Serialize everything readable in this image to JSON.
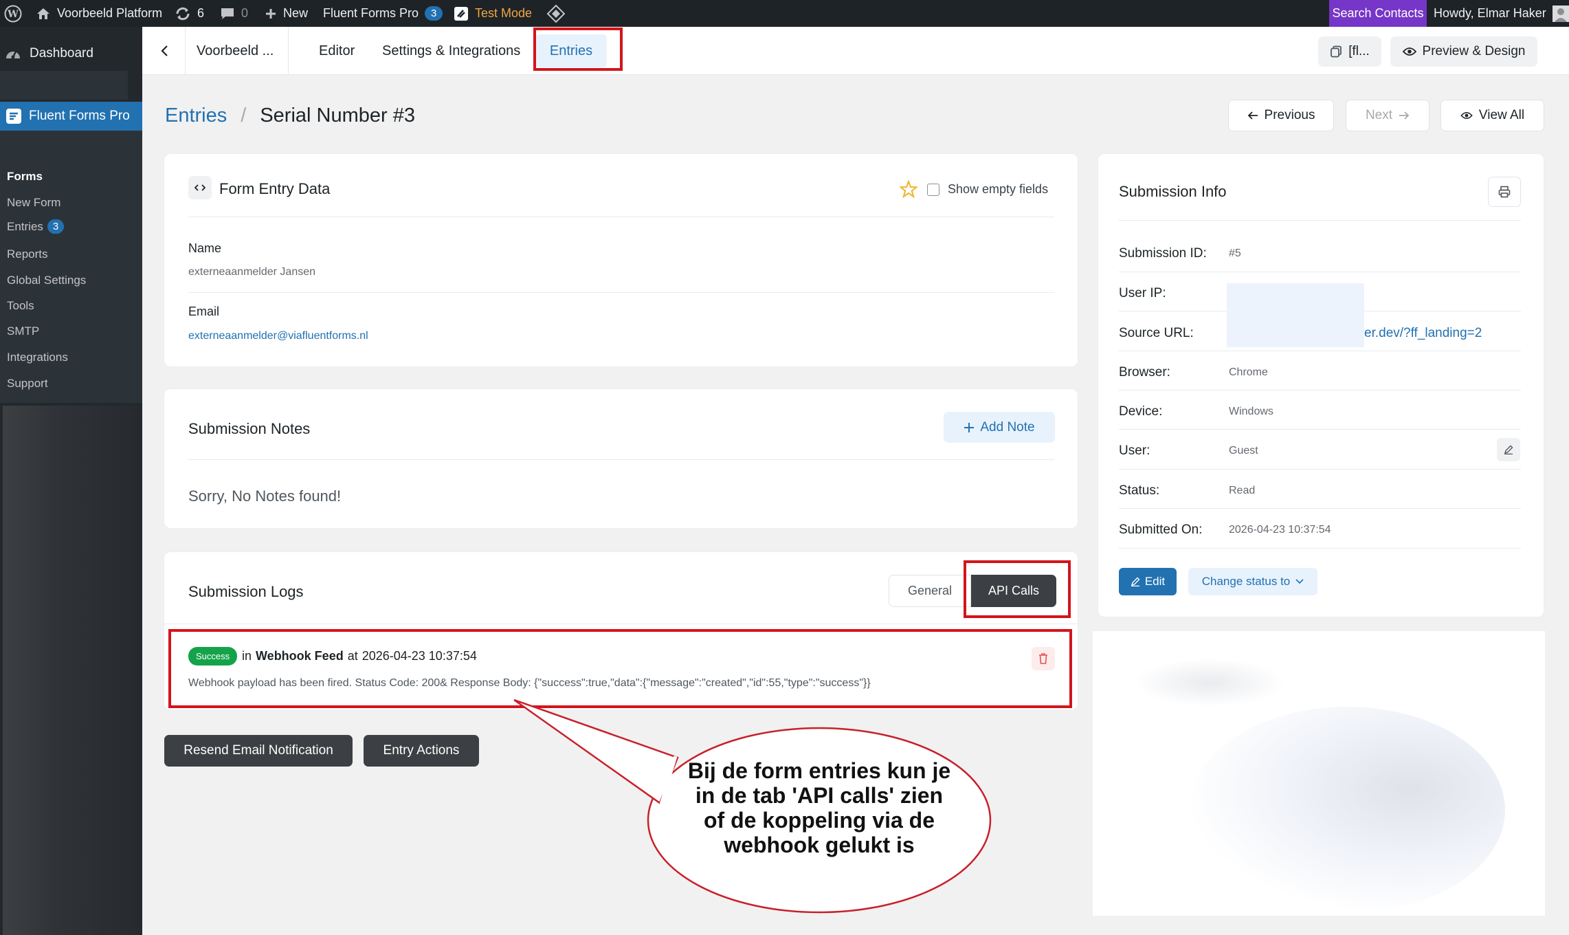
{
  "admin_bar": {
    "site_name": "Voorbeeld Platform",
    "updates_count": "6",
    "comments_count": "0",
    "new_label": "New",
    "plugin_label": "Fluent Forms Pro",
    "plugin_count": "3",
    "test_mode_label": "Test Mode",
    "search_contacts_label": "Search Contacts",
    "greeting": "Howdy, Elmar Haker"
  },
  "sidebar": {
    "dashboard_label": "Dashboard",
    "plugin_label": "Fluent Forms Pro",
    "items": [
      {
        "label": "Forms"
      },
      {
        "label": "New Form"
      },
      {
        "label": "Entries",
        "badge": "3"
      },
      {
        "label": "Reports"
      },
      {
        "label": "Global Settings"
      },
      {
        "label": "Tools"
      },
      {
        "label": "SMTP"
      },
      {
        "label": "Integrations"
      },
      {
        "label": "Support"
      }
    ]
  },
  "topnav": {
    "form_name": "Voorbeeld ...",
    "tabs": [
      {
        "label": "Editor"
      },
      {
        "label": "Settings & Integrations"
      },
      {
        "label": "Entries"
      }
    ],
    "shortcode_label": "[fl...",
    "preview_label": "Preview & Design"
  },
  "breadcrumb": {
    "root": "Entries",
    "separator": "/",
    "current": "Serial Number #3"
  },
  "nav_buttons": {
    "previous": "Previous",
    "next": "Next",
    "view_all": "View All"
  },
  "entry_data": {
    "title": "Form Entry Data",
    "show_empty_label": "Show empty fields",
    "fields": [
      {
        "label": "Name",
        "value": "externeaanmelder Jansen"
      },
      {
        "label": "Email",
        "value": "externeaanmelder@viafluentforms.nl"
      }
    ]
  },
  "notes": {
    "title": "Submission Notes",
    "add_label": "Add Note",
    "empty_text": "Sorry, No Notes found!"
  },
  "logs": {
    "title": "Submission Logs",
    "tabs": [
      {
        "label": "General"
      },
      {
        "label": "API Calls"
      }
    ],
    "entry": {
      "status": "Success",
      "prefix": "in",
      "feed": "Webhook Feed",
      "at": "at",
      "date": "2026-04-23 10:37:54",
      "message": "Webhook payload has been fired. Status Code: 200& Response Body: {\"success\":true,\"data\":{\"message\":\"created\",\"id\":55,\"type\":\"success\"}}"
    }
  },
  "actions": {
    "resend": "Resend Email Notification",
    "entry_actions": "Entry Actions"
  },
  "info": {
    "title": "Submission Info",
    "rows": [
      {
        "label": "Submission ID:",
        "value": "#5"
      },
      {
        "label": "User IP:",
        "value": ""
      },
      {
        "label": "Source URL:",
        "value": "er.dev/?ff_landing=2"
      },
      {
        "label": "Browser:",
        "value": "Chrome"
      },
      {
        "label": "Device:",
        "value": "Windows"
      },
      {
        "label": "User:",
        "value": "Guest"
      },
      {
        "label": "Status:",
        "value": "Read"
      },
      {
        "label": "Submitted On:",
        "value": "2026-04-23 10:37:54"
      }
    ],
    "edit_label": "Edit",
    "change_status_label": "Change status to"
  },
  "callout": {
    "lines": [
      "Bij de form entries kun je",
      "in de tab 'API calls' zien",
      "of de koppeling via de",
      "webhook gelukt is"
    ]
  },
  "colors": {
    "accent": "#2271b1",
    "highlight": "#d3141b",
    "success": "#15a34a",
    "admin_bar": "#1d2327",
    "test_mode": "#f0a542",
    "search_contacts_bg": "#7636c7"
  }
}
